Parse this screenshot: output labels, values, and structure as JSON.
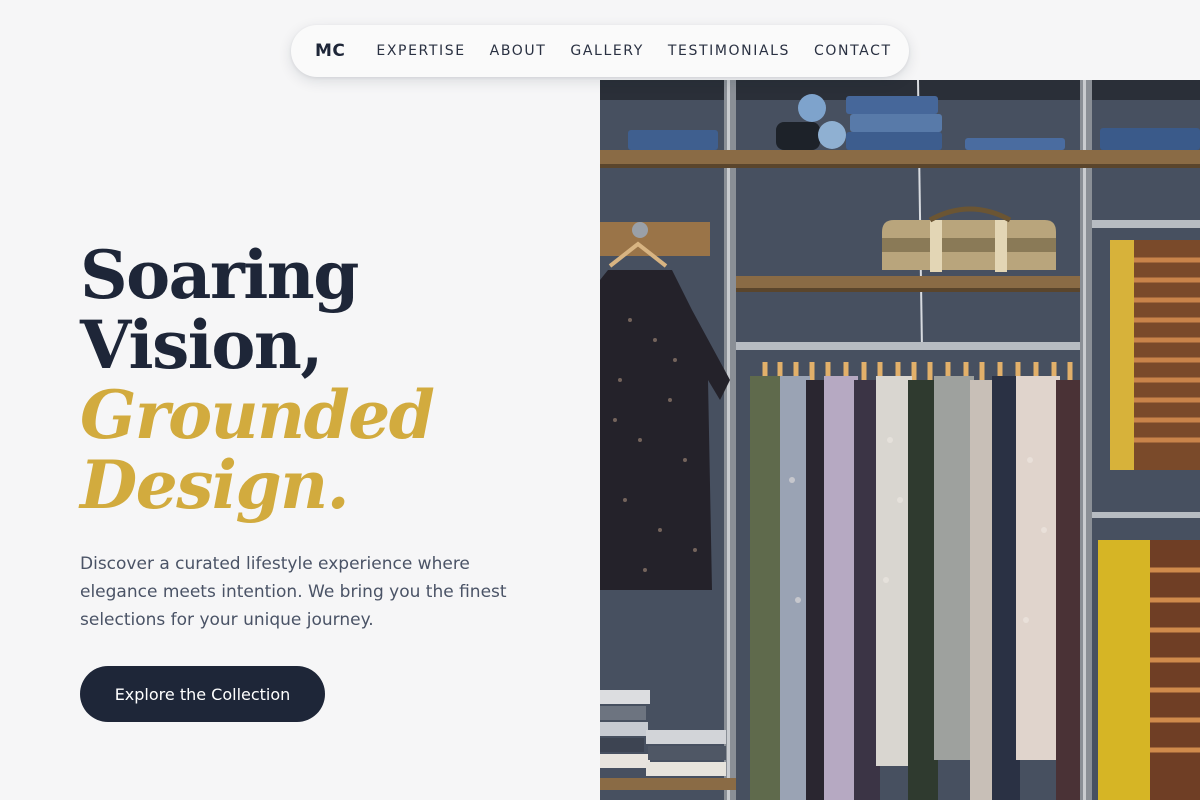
{
  "nav": {
    "logo": "MC",
    "links": [
      "EXPERTISE",
      "ABOUT",
      "GALLERY",
      "TESTIMONIALS",
      "CONTACT"
    ]
  },
  "hero": {
    "headline_line1": "Soaring",
    "headline_line2": "Vision,",
    "headline_accent1": "Grounded",
    "headline_accent2": "Design.",
    "description": "Discover a curated lifestyle experience where elegance meets intention. We bring you the finest selections for your unique journey.",
    "cta_label": "Explore the Collection"
  },
  "image": {
    "subject": "clothing rack with shelves of folded denim and a canvas bag"
  },
  "colors": {
    "background": "#f6f6f7",
    "primary": "#1e2638",
    "accent": "#d2ab3e",
    "body_text": "#4a5366"
  }
}
